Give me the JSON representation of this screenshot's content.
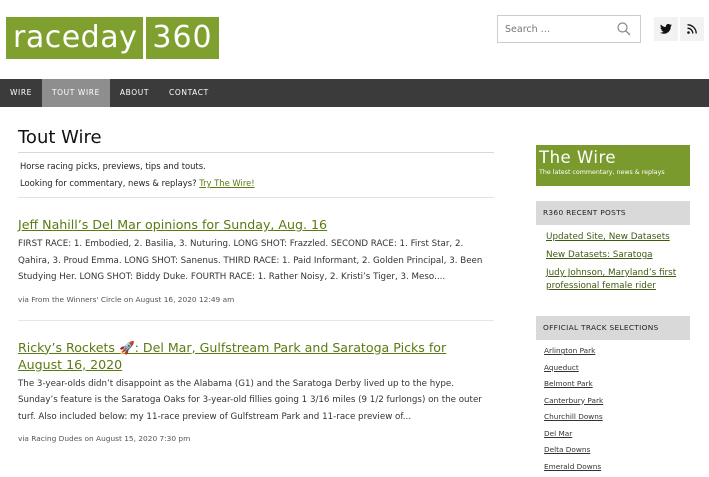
{
  "header": {
    "logo_part1": "raceday",
    "logo_part2": "360",
    "search_placeholder": "Search …",
    "social": [
      {
        "icon": "twitter-icon",
        "glyph": "𝕏"
      },
      {
        "icon": "rss-icon",
        "glyph": "ρ"
      }
    ]
  },
  "nav": {
    "items": [
      {
        "label": "WIRE",
        "active": false
      },
      {
        "label": "TOUT WIRE",
        "active": true
      },
      {
        "label": "ABOUT",
        "active": false
      },
      {
        "label": "CONTACT",
        "active": false
      }
    ]
  },
  "main": {
    "title": "Tout Wire",
    "intro_line1": "Horse racing picks, previews, tips and touts.",
    "intro_line2_prefix": "Looking for commentary, news & replays?",
    "intro_link": "Try The Wire!",
    "posts": [
      {
        "title": "Jeff Nahill’s Del Mar opinions for Sunday, Aug. 16",
        "excerpt": "FIRST RACE: 1. Embodied, 2. Basilia, 3. Nuturing. LONG SHOT: Frazzled. SECOND RACE: 1. First Star, 2. Qahira, 3. Proud Emma. LONG SHOT: Sanenus. THIRD RACE: 1. Paid Informant, 2. Golden Principal, 3. Been Studying Her. LONG SHOT: Biddy Duke. FOURTH RACE: 1. Rather Noisy, 2. Kristi’s Tiger, 3. Meso....",
        "via": "via From the Winners' Circle on August 16, 2020 12:49 am"
      },
      {
        "title": "Ricky’s Rockets 🚀: Del Mar, Gulfstream Park and Saratoga Picks for August 16, 2020",
        "excerpt": "The 3-year-olds didn’t disappoint as the Alabama (G1) and the Saratoga Derby lived up to the hype. Sunday’s feature is the Saratoga Oaks for 3-year-old fillies going 1 3/16 miles (9 1/2 furlongs) on the outer turf. Also included below: my 11-race preview of Gulfstream Park and 11-race preview of...",
        "via": "via Racing Dudes on August 15, 2020 7:30 pm"
      }
    ]
  },
  "sidebar": {
    "wire_box_title": "The Wire",
    "wire_box_subtitle": "The latest commentary, news & replays",
    "recent_heading": "R360 RECENT POSTS",
    "recent_posts": [
      "Updated Site, New Datasets",
      "New Datasets: Saratoga",
      "Judy Johnson, Maryland’s first professional female rider"
    ],
    "tracks_heading": "OFFICIAL TRACK SELECTIONS",
    "tracks": [
      "Arlington Park",
      "Aqueduct",
      "Belmont Park",
      "Canterbury Park",
      "Churchill Downs",
      "Del Mar",
      "Delta Downs",
      "Emerald Downs"
    ]
  },
  "colors": {
    "brand_green": "#7f9f2f",
    "link_green": "#5a7a12",
    "nav_bg": "#3b3b3b"
  }
}
